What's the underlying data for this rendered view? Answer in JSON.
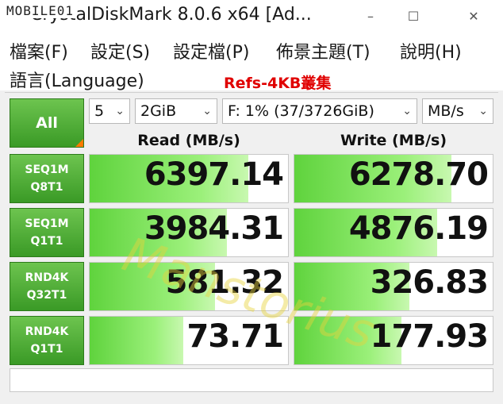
{
  "window": {
    "title": "CrystalDiskMark 8.0.6 x64 [Ad...",
    "minimize": "–",
    "maximize": "☐",
    "close": "✕"
  },
  "watermark_logo": "MOBILE01",
  "watermark_text": "Manstorius",
  "menu": {
    "file": "檔案(F)",
    "settings": "設定(S)",
    "profile": "設定檔(P)",
    "theme": "佈景主題(T)",
    "help": "說明(H)",
    "language": "語言(Language)"
  },
  "annotation": "Refs-4KB叢集",
  "controls": {
    "all_label": "All",
    "count": "5",
    "size": "2GiB",
    "drive": "F: 1% (37/3726GiB)",
    "unit": "MB/s"
  },
  "headers": {
    "read": "Read (MB/s)",
    "write": "Write (MB/s)"
  },
  "rows": [
    {
      "label1": "SEQ1M",
      "label2": "Q8T1",
      "read": "6397.14",
      "write": "6278.70",
      "read_fill": 0.8,
      "write_fill": 0.79
    },
    {
      "label1": "SEQ1M",
      "label2": "Q1T1",
      "read": "3984.31",
      "write": "4876.19",
      "read_fill": 0.69,
      "write_fill": 0.72
    },
    {
      "label1": "RND4K",
      "label2": "Q32T1",
      "read": "581.32",
      "write": "326.83",
      "read_fill": 0.63,
      "write_fill": 0.58
    },
    {
      "label1": "RND4K",
      "label2": "Q1T1",
      "read": "73.71",
      "write": "177.93",
      "read_fill": 0.47,
      "write_fill": 0.54
    }
  ],
  "status_text": ""
}
